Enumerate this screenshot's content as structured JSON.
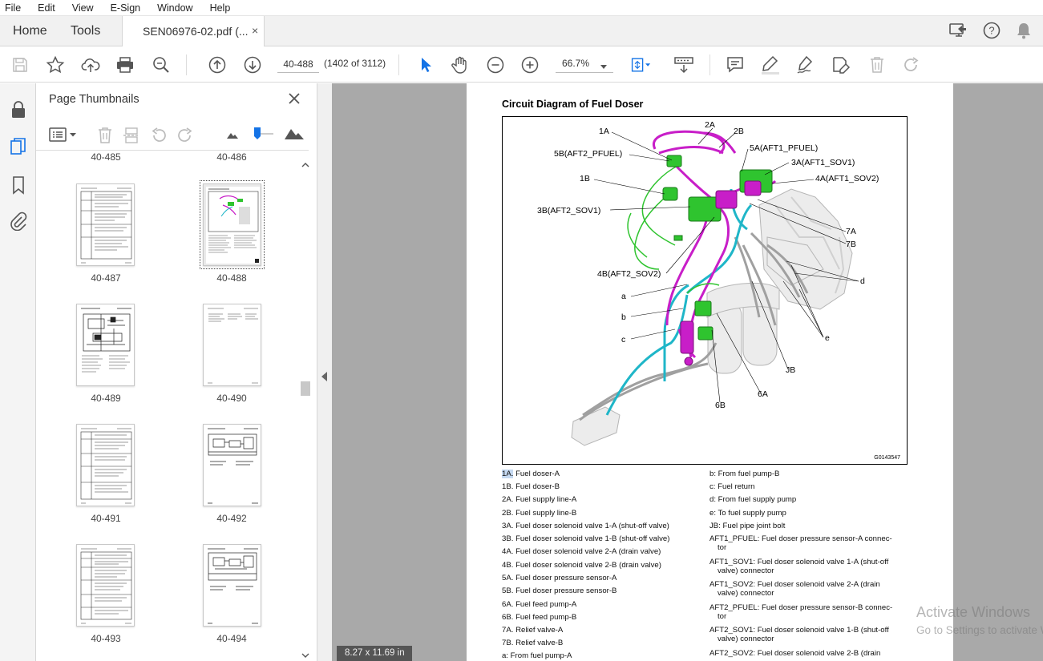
{
  "menu": [
    "File",
    "Edit",
    "View",
    "E-Sign",
    "Window",
    "Help"
  ],
  "tabs": {
    "home": "Home",
    "tools": "Tools",
    "document": "SEN06976-02.pdf (...",
    "close": "×"
  },
  "toolbar": {
    "page_value": "40-488",
    "page_count": "(1402 of 3112)",
    "zoom": "66.7%"
  },
  "panel": {
    "title": "Page Thumbnails",
    "partial_top": [
      "40-485",
      "40-486"
    ],
    "thumbnails": [
      {
        "label": "40-487"
      },
      {
        "label": "40-488",
        "selected": true
      },
      {
        "label": "40-489"
      },
      {
        "label": "40-490"
      },
      {
        "label": "40-491"
      },
      {
        "label": "40-492"
      },
      {
        "label": "40-493"
      },
      {
        "label": "40-494"
      }
    ]
  },
  "document": {
    "title": "Circuit Diagram of Fuel Doser",
    "figure_code": "G0143547",
    "callouts": {
      "c1A": "1A",
      "c2A": "2A",
      "c2B": "2B",
      "c5B": "5B(AFT2_PFUEL)",
      "c5A": "5A(AFT1_PFUEL)",
      "c3A": "3A(AFT1_SOV1)",
      "c4A": "4A(AFT1_SOV2)",
      "c1B": "1B",
      "c3B": "3B(AFT2_SOV1)",
      "c7A": "7A",
      "c7B": "7B",
      "c4B": "4B(AFT2_SOV2)",
      "cd": "d",
      "ca": "a",
      "cb": "b",
      "cc": "c",
      "ce": "e",
      "cJB": "JB",
      "c6A": "6A",
      "c6B": "6B"
    },
    "legend_left": [
      {
        "code": "1A.",
        "text": " Fuel doser-A"
      },
      {
        "code": "1B.",
        "text": " Fuel doser-B"
      },
      {
        "code": "2A.",
        "text": " Fuel supply line-A"
      },
      {
        "code": "2B.",
        "text": " Fuel supply line-B"
      },
      {
        "code": "3A.",
        "text": " Fuel doser solenoid valve 1-A (shut-off valve)"
      },
      {
        "code": "3B.",
        "text": " Fuel doser solenoid valve 1-B (shut-off valve)"
      },
      {
        "code": "4A.",
        "text": " Fuel doser solenoid valve 2-A (drain valve)"
      },
      {
        "code": "4B.",
        "text": " Fuel doser solenoid valve 2-B (drain valve)"
      },
      {
        "code": "5A.",
        "text": " Fuel doser pressure sensor-A"
      },
      {
        "code": "5B.",
        "text": " Fuel doser pressure sensor-B"
      },
      {
        "code": "6A.",
        "text": " Fuel feed pump-A"
      },
      {
        "code": "6B.",
        "text": " Fuel feed pump-B"
      },
      {
        "code": "7A.",
        "text": " Relief valve-A"
      },
      {
        "code": "7B.",
        "text": " Relief valve-B"
      },
      {
        "code": "a:",
        "text": " From fuel pump-A"
      }
    ],
    "legend_right": [
      {
        "l1": "b: From fuel pump-B",
        "l2": ""
      },
      {
        "l1": "c: Fuel return",
        "l2": ""
      },
      {
        "l1": "d: From fuel supply pump",
        "l2": ""
      },
      {
        "l1": "e: To fuel supply pump",
        "l2": ""
      },
      {
        "l1": "JB: Fuel pipe joint bolt",
        "l2": ""
      },
      {
        "l1": "AFT1_PFUEL: Fuel doser pressure sensor-A connec-",
        "l2": "tor"
      },
      {
        "l1": "AFT1_SOV1: Fuel doser solenoid valve 1-A (shut-off",
        "l2": "valve) connector"
      },
      {
        "l1": "AFT1_SOV2: Fuel doser solenoid valve 2-A (drain",
        "l2": "valve) connector"
      },
      {
        "l1": "AFT2_PFUEL: Fuel doser pressure sensor-B connec-",
        "l2": "tor"
      },
      {
        "l1": "AFT2_SOV1: Fuel doser solenoid valve 1-B (shut-off",
        "l2": "valve) connector"
      },
      {
        "l1": "AFT2_SOV2: Fuel doser solenoid valve 2-B (drain",
        "l2": ""
      }
    ]
  },
  "status": {
    "page_size": "8.27 x 11.69 in"
  },
  "watermark": {
    "line1": "Activate Windows",
    "line2": "Go to Settings to activate Windows."
  },
  "colors": {
    "accent": "#1473e6",
    "magenta": "#c81ec8",
    "green": "#2fc42f",
    "cyan": "#1fb6c8"
  }
}
